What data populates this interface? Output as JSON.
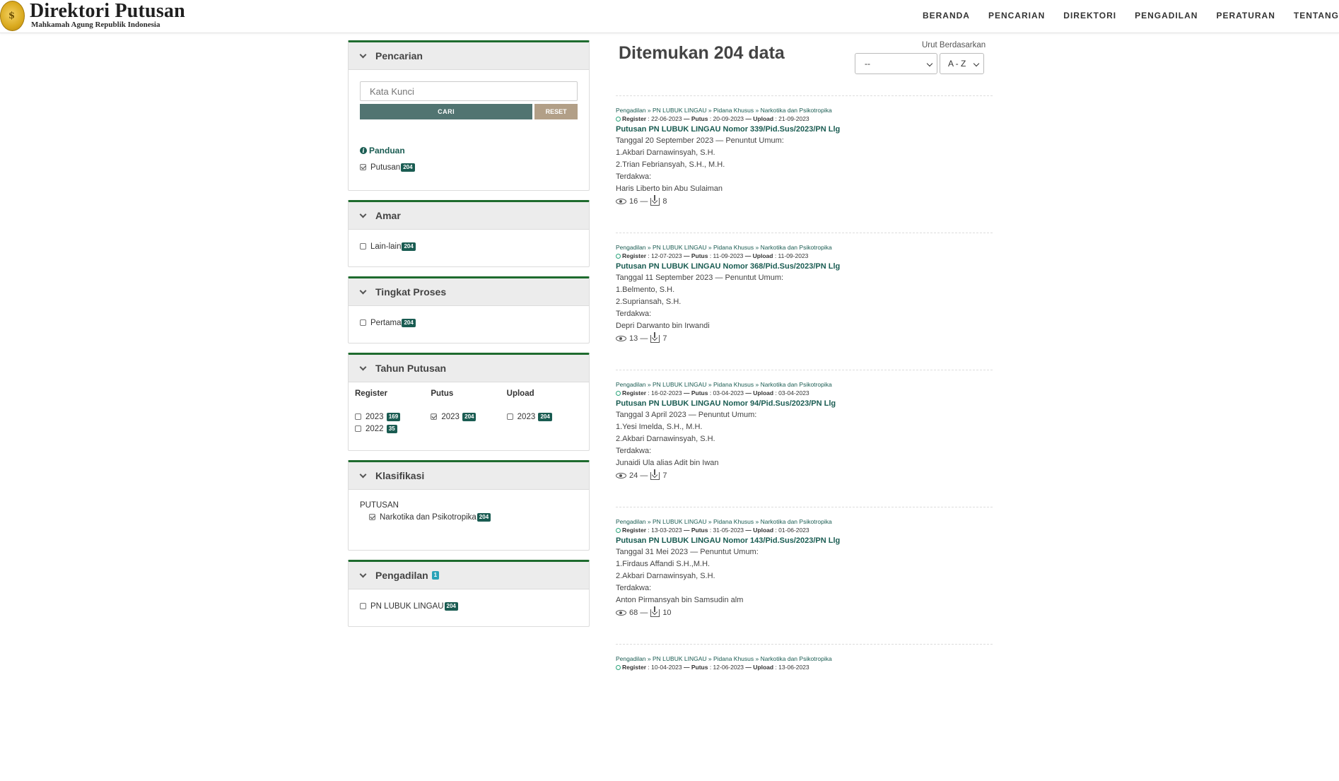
{
  "header": {
    "brand_title": "Direktori Putusan",
    "brand_subtitle": "Mahkamah Agung Republik Indonesia",
    "nav": [
      "BERANDA",
      "PENCARIAN",
      "DIREKTORI",
      "PENGADILAN",
      "PERATURAN",
      "TENTANG"
    ]
  },
  "sidebar": {
    "pencarian": {
      "title": "Pencarian",
      "placeholder": "Kata Kunci",
      "cari_label": "CARI",
      "reset_label": "RESET",
      "panduan_label": "Panduan",
      "putusan_label": "Putusan",
      "putusan_count": "204"
    },
    "amar": {
      "title": "Amar",
      "item_label": "Lain-lain",
      "item_count": "204"
    },
    "tingkat": {
      "title": "Tingkat Proses",
      "item_label": "Pertama",
      "item_count": "204"
    },
    "tahun": {
      "title": "Tahun Putusan",
      "register_label": "Register",
      "putus_label": "Putus",
      "upload_label": "Upload",
      "register": [
        {
          "year": "2023",
          "count": "169"
        },
        {
          "year": "2022",
          "count": "35"
        }
      ],
      "putus": [
        {
          "year": "2023",
          "count": "204"
        }
      ],
      "upload": [
        {
          "year": "2023",
          "count": "204"
        }
      ]
    },
    "klasifikasi": {
      "title": "Klasifikasi",
      "group": "PUTUSAN",
      "item_label": "Narkotika dan Psikotropika",
      "item_count": "204"
    },
    "pengadilan": {
      "title": "Pengadilan",
      "title_count": "1",
      "item_label": "PN LUBUK LINGAU",
      "item_count": "204"
    }
  },
  "main": {
    "found_text": "Ditemukan 204 data",
    "sort_label": "Urut Berdasarkan",
    "sort_value": "--",
    "order_value": "A - Z",
    "results": [
      {
        "crumb": "Pengadilan » PN LUBUK LINGAU » Pidana Khusus » Narkotika dan Psikotropika",
        "meta_register": "Register",
        "register": ": 22-06-2023",
        "putus": ": 20-09-2023",
        "upload": ": 21-09-2023",
        "title": "Putusan PN LUBUK LINGAU Nomor 339/Pid.Sus/2023/PN Llg",
        "date_line": "Tanggal 20 September 2023 — Penuntut Umum:",
        "pu1": "1.Akbari Darnawinsyah, S.H.",
        "pu2": "2.Trian Febriansyah, S.H., M.H.",
        "terdakwa_label": "Terdakwa:",
        "terdakwa": "Haris Liberto bin Abu Sulaiman",
        "views": "16",
        "downloads": "8"
      },
      {
        "crumb": "Pengadilan » PN LUBUK LINGAU » Pidana Khusus » Narkotika dan Psikotropika",
        "meta_register": "Register",
        "register": ": 12-07-2023",
        "putus": ": 11-09-2023",
        "upload": ": 11-09-2023",
        "title": "Putusan PN LUBUK LINGAU Nomor 368/Pid.Sus/2023/PN Llg",
        "date_line": "Tanggal 11 September 2023 — Penuntut Umum:",
        "pu1": "1.Belmento, S.H.",
        "pu2": "2.Supriansah, S.H.",
        "terdakwa_label": "Terdakwa:",
        "terdakwa": "Depri Darwanto bin Irwandi",
        "views": "13",
        "downloads": "7"
      },
      {
        "crumb": "Pengadilan » PN LUBUK LINGAU » Pidana Khusus » Narkotika dan Psikotropika",
        "meta_register": "Register",
        "register": ": 16-02-2023",
        "putus": ": 03-04-2023",
        "upload": ": 03-04-2023",
        "title": "Putusan PN LUBUK LINGAU Nomor 94/Pid.Sus/2023/PN Llg",
        "date_line": "Tanggal 3 April 2023 — Penuntut Umum:",
        "pu1": "1.Yesi Imelda, S.H., M.H.",
        "pu2": "2.Akbari Darnawinsyah, S.H.",
        "terdakwa_label": "Terdakwa:",
        "terdakwa": "Junaidi Ula alias Adit bin Iwan",
        "views": "24",
        "downloads": "7"
      },
      {
        "crumb": "Pengadilan » PN LUBUK LINGAU » Pidana Khusus » Narkotika dan Psikotropika",
        "meta_register": "Register",
        "register": ": 13-03-2023",
        "putus": ": 31-05-2023",
        "upload": ": 01-06-2023",
        "title": "Putusan PN LUBUK LINGAU Nomor 143/Pid.Sus/2023/PN Llg",
        "date_line": "Tanggal 31 Mei 2023 — Penuntut Umum:",
        "pu1": "1.Firdaus Affandi S.H.,M.H.",
        "pu2": "2.Akbari Darnawinsyah, S.H.",
        "terdakwa_label": "Terdakwa:",
        "terdakwa": "Anton Pirmansyah bin Samsudin alm",
        "views": "68",
        "downloads": "10"
      },
      {
        "crumb": "Pengadilan » PN LUBUK LINGAU » Pidana Khusus » Narkotika dan Psikotropika",
        "meta_register": "Register",
        "register": ": 10-04-2023",
        "putus": ": 12-06-2023",
        "upload": ": 13-06-2023",
        "title": "",
        "date_line": "",
        "pu1": "",
        "pu2": "",
        "terdakwa_label": "",
        "terdakwa": "",
        "views": "",
        "downloads": ""
      }
    ],
    "sep_putus": "— Putus",
    "sep_upload": "— Upload",
    "stat_sep": "—"
  }
}
